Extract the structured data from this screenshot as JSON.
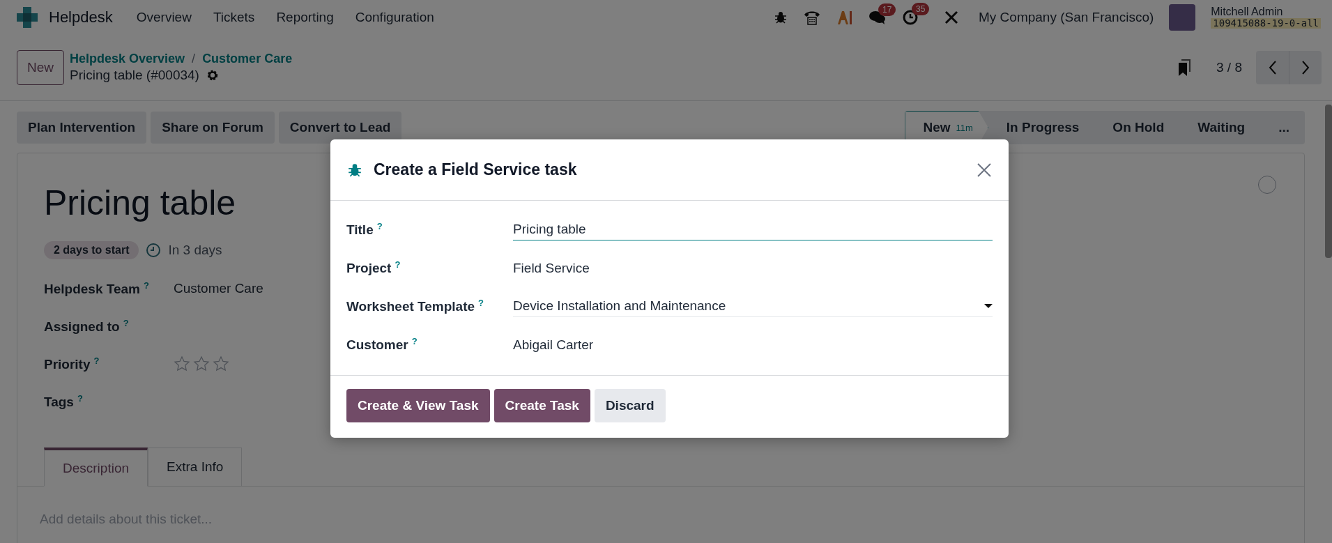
{
  "navbar": {
    "app_name": "Helpdesk",
    "menu": [
      "Overview",
      "Tickets",
      "Reporting",
      "Configuration"
    ],
    "chat_count": "17",
    "activity_count": "35",
    "company": "My Company (San Francisco)",
    "user": "Mitchell Admin",
    "database": "109415088-19-0-all"
  },
  "control_panel": {
    "new_button": "New",
    "breadcrumbs": [
      "Helpdesk Overview",
      "Customer Care"
    ],
    "breadcrumb_separator": "/",
    "record": "Pricing table (#00034)",
    "pager": "3 / 8"
  },
  "actions": [
    "Plan Intervention",
    "Share on Forum",
    "Convert to Lead"
  ],
  "stages": [
    {
      "label": "New",
      "badge": "11m",
      "selected": true
    },
    {
      "label": "In Progress",
      "selected": false
    },
    {
      "label": "On Hold",
      "selected": false
    },
    {
      "label": "Waiting",
      "selected": false
    },
    {
      "label": "...",
      "selected": false
    }
  ],
  "ticket": {
    "title": "Pricing table",
    "deadline_badge": "2 days to start",
    "date": "In 3 days",
    "fields": [
      {
        "label": "Helpdesk Team",
        "help": "?",
        "value": "Customer Care",
        "kind": "text"
      },
      {
        "label": "Assigned to",
        "help": "?",
        "kind": "text"
      },
      {
        "label": "Priority",
        "help": "?",
        "kind": "stars",
        "stars": 0
      },
      {
        "label": "Tags",
        "help": "?",
        "kind": "text"
      }
    ],
    "tabs": [
      {
        "label": "Description",
        "selected": true
      },
      {
        "label": "Extra Info",
        "selected": false
      }
    ],
    "description_placeholder": "Add details about this ticket..."
  },
  "dialog": {
    "title": "Create a Field Service task",
    "fields": [
      {
        "label": "Title",
        "help": "?",
        "value": "Pricing table",
        "kind": "input"
      },
      {
        "label": "Project",
        "help": "?",
        "value": "Field Service",
        "kind": "text"
      },
      {
        "label": "Worksheet Template",
        "help": "?",
        "value": "Device Installation and Maintenance",
        "kind": "select"
      },
      {
        "label": "Customer",
        "help": "?",
        "value": "Abigail Carter",
        "kind": "text"
      }
    ],
    "buttons": [
      {
        "label": "Create & View Task",
        "kind": "primary"
      },
      {
        "label": "Create Task",
        "kind": "primary"
      },
      {
        "label": "Discard",
        "kind": "secondary"
      }
    ]
  }
}
